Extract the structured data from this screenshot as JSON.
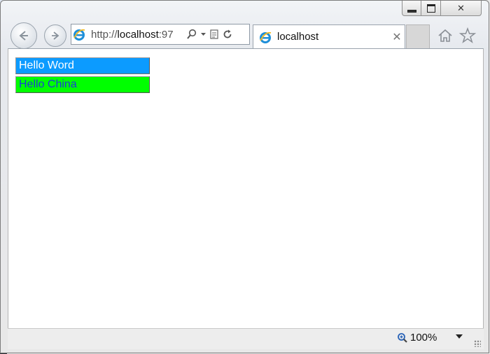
{
  "browser": {
    "address": {
      "protocol": "http://",
      "host": "localhost",
      "port_fragment": ":97"
    },
    "tab": {
      "title": "localhost"
    },
    "statusbar": {
      "zoom": "100%"
    }
  },
  "page": {
    "items": [
      {
        "label": "Hello Word",
        "background": "#0c9bff",
        "color": "#ffffff"
      },
      {
        "label": "Hello China",
        "background": "#00ff00",
        "color": "#1a3fd6"
      }
    ]
  },
  "icons": {
    "back": "back-arrow-icon",
    "forward": "forward-arrow-icon",
    "ie": "internet-explorer-icon",
    "search": "search-icon",
    "compat": "compatibility-view-icon",
    "refresh": "refresh-icon",
    "home": "home-icon",
    "favorites": "star-icon",
    "zoom": "zoom-icon"
  }
}
